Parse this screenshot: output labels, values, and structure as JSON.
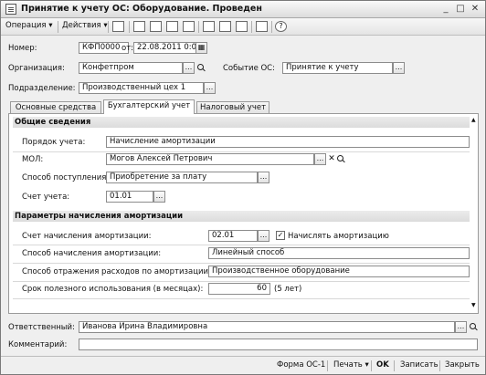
{
  "window": {
    "title": "Принятие к учету ОС: Оборудование. Проведен"
  },
  "toolbar": {
    "operation_menu": "Операция",
    "actions_menu": "Действия",
    "help_icon": "?"
  },
  "header": {
    "number_label": "Номер:",
    "number_value": "КФП0000",
    "from_label": "от:",
    "date_value": "22.08.2011  0:00",
    "org_label": "Организация:",
    "org_value": "Конфетпром",
    "event_label": "Событие ОС:",
    "event_value": "Принятие к учету",
    "division_label": "Подразделение:",
    "division_value": "Производственный цех 1",
    "dots": "..."
  },
  "tabs": [
    {
      "label": "Основные средства"
    },
    {
      "label": "Бухгалтерский учет"
    },
    {
      "label": "Налоговый учет"
    }
  ],
  "general": {
    "section_title": "Общие сведения",
    "order_label": "Порядок учета:",
    "order_value": "Начисление амортизации",
    "mol_label": "МОЛ:",
    "mol_value": "Могов Алексей Петрович",
    "receipt_label": "Способ поступления:",
    "receipt_value": "Приобретение за плату",
    "account_label": "Счет учета:",
    "account_value": "01.01"
  },
  "depreciation": {
    "section_title": "Параметры начисления амортизации",
    "account_label": "Счет начисления амортизации:",
    "account_value": "02.01",
    "accrue_label": "Начислять амортизацию",
    "accrue_checked": true,
    "method_label": "Способ начисления амортизации:",
    "method_value": "Линейный способ",
    "expense_label": "Способ отражения расходов по амортизации:",
    "expense_value": "Производственное оборудование",
    "term_label": "Срок полезного использования (в месяцах):",
    "term_value": "60",
    "term_years": "(5 лет)"
  },
  "footer_fields": {
    "responsible_label": "Ответственный:",
    "responsible_value": "Иванова Ирина Владимировна",
    "comment_label": "Комментарий:",
    "comment_value": ""
  },
  "bottombar": {
    "form_label": "Форма ОС-1",
    "print_label": "Печать",
    "ok_label": "OK",
    "save_label": "Записать",
    "close_label": "Закрыть"
  }
}
